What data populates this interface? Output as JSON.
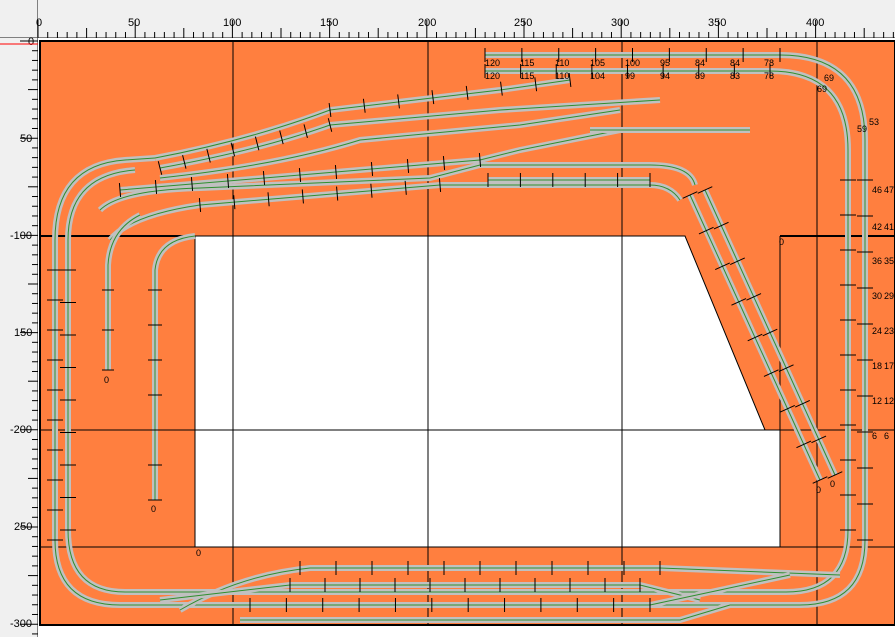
{
  "ruler": {
    "top_labels": [
      "0",
      "50",
      "100",
      "150",
      "200",
      "250",
      "300",
      "350",
      "400"
    ],
    "left_labels": [
      "0",
      "50",
      "-100",
      "150",
      "-200",
      "250",
      "-300"
    ]
  },
  "colors": {
    "baseboard": "#ff7f3f",
    "hole": "#ffffff",
    "track_ballast": "#c0c0c0",
    "rail": "#2f8f2f",
    "ruler_bg": "#f0f0f0",
    "grid": "#000000"
  },
  "track_labels": {
    "top_row_upper": [
      "120",
      "115",
      "110",
      "105",
      "100",
      "95",
      "84",
      "84",
      "78"
    ],
    "top_row_lower": [
      "120",
      "115",
      "110",
      "104",
      "99",
      "94",
      "89",
      "83",
      "78"
    ],
    "right_col_left": [
      "46",
      "42",
      "36",
      "30",
      "24",
      "18",
      "12",
      "6"
    ],
    "right_col_right": [
      "47",
      "41",
      "35",
      "29",
      "23",
      "17",
      "12",
      "6"
    ],
    "curve_labels": [
      "69",
      "69",
      "59",
      "53"
    ],
    "zero": "0"
  }
}
